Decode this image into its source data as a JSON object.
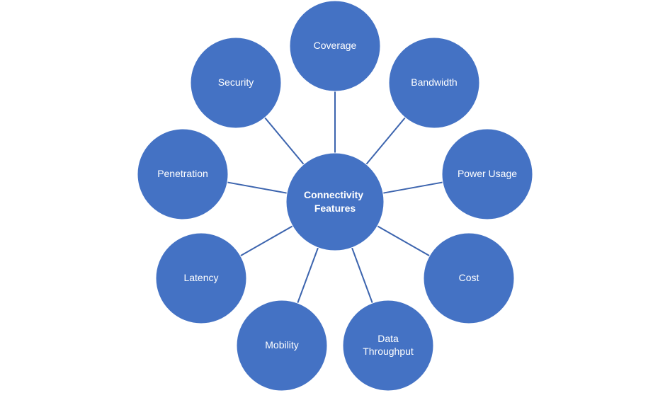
{
  "diagram": {
    "type": "radial-hub",
    "colors": {
      "node_fill": "#4472C4",
      "connector": "#3C64AE",
      "text": "#FFFFFF",
      "background": "#FFFFFF"
    },
    "center": {
      "label_lines": [
        "Connectivity",
        "Features"
      ]
    },
    "nodes": [
      {
        "id": "coverage",
        "label_lines": [
          "Coverage"
        ]
      },
      {
        "id": "bandwidth",
        "label_lines": [
          "Bandwidth"
        ]
      },
      {
        "id": "power-usage",
        "label_lines": [
          "Power Usage"
        ]
      },
      {
        "id": "cost",
        "label_lines": [
          "Cost"
        ]
      },
      {
        "id": "data-throughput",
        "label_lines": [
          "Data",
          "Throughput"
        ]
      },
      {
        "id": "mobility",
        "label_lines": [
          "Mobility"
        ]
      },
      {
        "id": "latency",
        "label_lines": [
          "Latency"
        ]
      },
      {
        "id": "penetration",
        "label_lines": [
          "Penetration"
        ]
      },
      {
        "id": "security",
        "label_lines": [
          "Security"
        ]
      }
    ]
  }
}
